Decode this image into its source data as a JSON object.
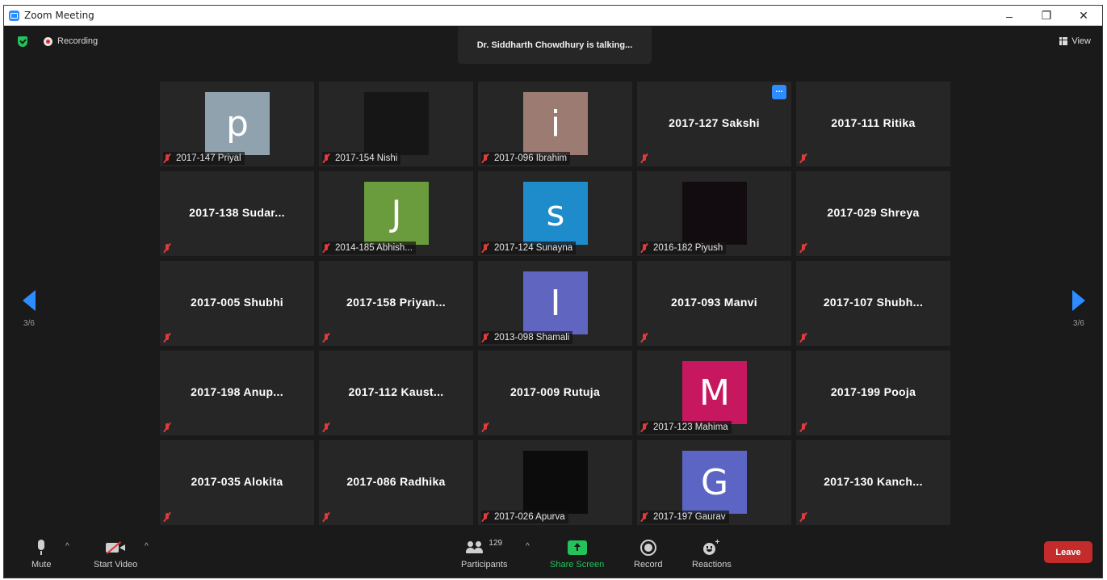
{
  "window": {
    "title": "Zoom Meeting",
    "minimize": "–",
    "restore": "❐",
    "close": "✕"
  },
  "meeting": {
    "recording_label": "Recording",
    "talking": "Dr. Siddharth Chowdhury is talking...",
    "view_label": "View",
    "page_indicator": "3/6"
  },
  "tiles": [
    {
      "name": "2017-147 Priyal",
      "avatar": "p",
      "color": "#8fa2ad"
    },
    {
      "name": "2017-154 Nishi",
      "avatar": "",
      "color": "#161616"
    },
    {
      "name": "2017-096 Ibrahim",
      "avatar": "i",
      "color": "#9c7b72"
    },
    {
      "name": "2017-127 Sakshi",
      "menu": "..."
    },
    {
      "name": "2017-111 Ritika"
    },
    {
      "name": "2017-138 Sudar..."
    },
    {
      "name": "2014-185 Abhish...",
      "avatar": "J",
      "color": "#6a9b3c"
    },
    {
      "name": "2017-124 Sunayna",
      "avatar": "s",
      "color": "#1e8ccb"
    },
    {
      "name": "2016-182 Piyush",
      "avatar": "",
      "color": "#120c10"
    },
    {
      "name": "2017-029 Shreya"
    },
    {
      "name": "2017-005 Shubhi"
    },
    {
      "name": "2017-158 Priyan..."
    },
    {
      "name": "2013-098 Shamali",
      "avatar": "I",
      "color": "#6066c0"
    },
    {
      "name": "2017-093 Manvi"
    },
    {
      "name": "2017-107 Shubh..."
    },
    {
      "name": "2017-198 Anup..."
    },
    {
      "name": "2017-112 Kaust..."
    },
    {
      "name": "2017-009 Rutuja"
    },
    {
      "name": "2017-123 Mahima",
      "avatar": "M",
      "color": "#c7175f"
    },
    {
      "name": "2017-199 Pooja"
    },
    {
      "name": "2017-035 Alokita"
    },
    {
      "name": "2017-086 Radhika"
    },
    {
      "name": "2017-026 Apurva",
      "avatar": "",
      "color": "#0c0c0c"
    },
    {
      "name": "2017-197 Gaurav",
      "avatar": "G",
      "color": "#5c65c4"
    },
    {
      "name": "2017-130 Kanch..."
    }
  ],
  "toolbar": {
    "mute": "Mute",
    "start_video": "Start Video",
    "participants": "Participants",
    "participant_count": "129",
    "share_screen": "Share Screen",
    "record": "Record",
    "reactions": "Reactions",
    "leave": "Leave",
    "caret": "^"
  },
  "colors": {
    "accent": "#2d8cff",
    "share": "#23c25a",
    "leave": "#c42c2c",
    "muted": "#e03a3a"
  }
}
